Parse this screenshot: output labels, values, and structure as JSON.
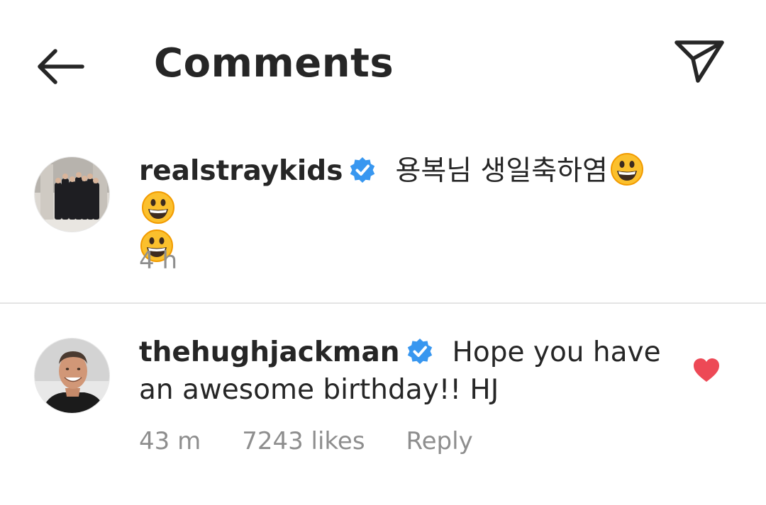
{
  "header": {
    "title": "Comments",
    "back_icon": "back-arrow-icon",
    "share_icon": "send-direct-icon"
  },
  "comments": [
    {
      "username": "realstraykids",
      "verified": true,
      "text": "용복님 생일축하염",
      "emoji_count": 3,
      "time": "4 h",
      "liked": false
    },
    {
      "username": "thehughjackman",
      "verified": true,
      "text": "Hope you have an awesome birthday!! HJ",
      "time": "43 m",
      "likes": "7243 likes",
      "reply_label": "Reply",
      "liked": true
    }
  ],
  "colors": {
    "verified": "#3897f0",
    "heart": "#ed4956",
    "meta": "#8e8e8e",
    "text": "#262626"
  }
}
